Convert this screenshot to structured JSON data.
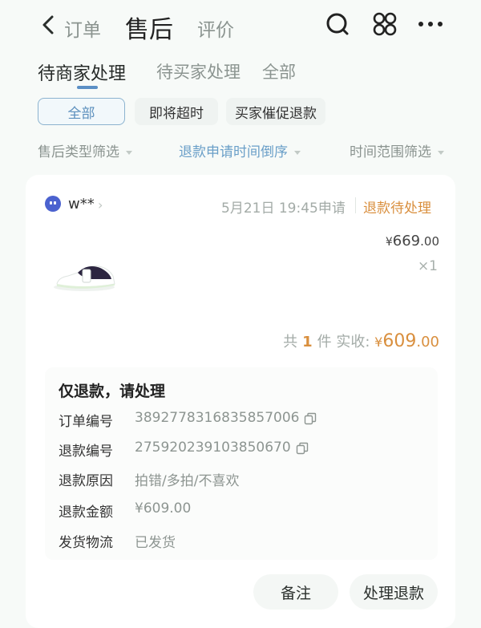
{
  "nav": {
    "orders": "订单",
    "after_sales": "售后",
    "reviews": "评价"
  },
  "tabs": [
    "待商家处理",
    "待买家处理",
    "全部"
  ],
  "chips": [
    "全部",
    "即将超时",
    "买家催促退款"
  ],
  "filters": {
    "type": "售后类型筛选",
    "sort": "退款申请时间倒序",
    "range": "时间范围筛选"
  },
  "order": {
    "shop_name": "w**",
    "apply_time": "5月21日 19:45申请",
    "status": "退款待处理",
    "price_symbol": "¥",
    "price_int": "669",
    "price_dec": ".00",
    "quantity": "×1",
    "total_prefix": "共",
    "total_count": "1",
    "total_suffix": "件  实收:",
    "paid_symbol": "¥",
    "paid_int": "609",
    "paid_dec": ".00"
  },
  "details": {
    "title": "仅退款，请处理",
    "rows": [
      {
        "label": "订单编号",
        "value": "3892778316835857006"
      },
      {
        "label": "退款编号",
        "value": "275920239103850670"
      },
      {
        "label": "退款原因",
        "value": "拍错/多拍/不喜欢"
      },
      {
        "label": "退款金额",
        "value": "¥609.00"
      },
      {
        "label": "发货物流",
        "value": "已发货"
      }
    ]
  },
  "actions": {
    "remark": "备注",
    "process_refund": "处理退款"
  },
  "colors": {
    "accent_blue": "#5b8fc5",
    "status_orange": "#d98f3e"
  }
}
